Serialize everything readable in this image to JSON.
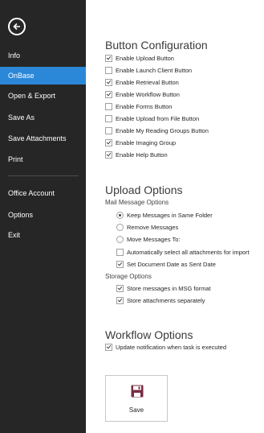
{
  "sidebar": {
    "items": [
      {
        "label": "Info",
        "active": false
      },
      {
        "label": "OnBase",
        "active": true
      },
      {
        "label": "Open & Export",
        "active": false
      },
      {
        "label": "Save As",
        "active": false
      },
      {
        "label": "Save Attachments",
        "active": false
      },
      {
        "label": "Print",
        "active": false
      },
      {
        "label": "Office Account",
        "active": false
      },
      {
        "label": "Options",
        "active": false
      },
      {
        "label": "Exit",
        "active": false
      }
    ],
    "background": "#262626",
    "active_color": "#2b88d8"
  },
  "button_config": {
    "title": "Button Configuration",
    "options": [
      {
        "label": "Enable Upload Button",
        "checked": true
      },
      {
        "label": "Enable Launch Client Button",
        "checked": false
      },
      {
        "label": "Enable Retrieval Button",
        "checked": true
      },
      {
        "label": "Enable Workflow Button",
        "checked": true
      },
      {
        "label": "Enable Forms Button",
        "checked": false
      },
      {
        "label": "Enable Upload from File Button",
        "checked": false
      },
      {
        "label": "Enable My Reading Groups Button",
        "checked": false
      },
      {
        "label": "Enable Imaging Group",
        "checked": true
      },
      {
        "label": "Enable Help Button",
        "checked": true
      }
    ]
  },
  "upload_options": {
    "title": "Upload Options",
    "mail_label": "Mail Message Options",
    "radios": [
      {
        "label": "Keep Messages in Same Folder",
        "selected": true
      },
      {
        "label": "Remove Messages",
        "selected": false
      },
      {
        "label": "Move Messages To:",
        "selected": false
      }
    ],
    "mail_checks": [
      {
        "label": "Automatically select all attachments for import",
        "checked": false
      },
      {
        "label": "Set Document Date as Sent Date",
        "checked": true
      }
    ],
    "storage_label": "Storage Options",
    "storage_checks": [
      {
        "label": "Store messages in MSG format",
        "checked": true
      },
      {
        "label": "Store attachments separately",
        "checked": true
      }
    ]
  },
  "workflow_options": {
    "title": "Workflow Options",
    "options": [
      {
        "label": "Update notification when task is executed",
        "checked": true
      }
    ]
  },
  "save_tile": {
    "label": "Save",
    "icon": "save-disk-icon",
    "icon_color": "#7b2c44"
  }
}
